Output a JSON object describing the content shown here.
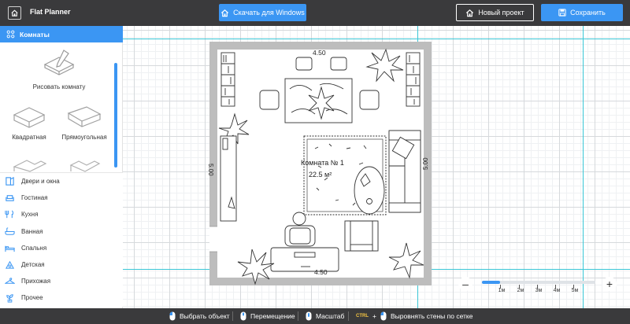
{
  "app": {
    "title": "Flat Planner",
    "download_label": "Скачать для Windows",
    "new_project_label": "Новый проект",
    "save_label": "Сохранить"
  },
  "sidebar": {
    "rooms_tab": "Комнаты",
    "draw_room": "Рисовать комнату",
    "square": "Квадратная",
    "rectangular": "Прямоугольная",
    "categories": [
      {
        "label": "Двери и окна",
        "icon": "door-icon"
      },
      {
        "label": "Гостиная",
        "icon": "sofa-icon"
      },
      {
        "label": "Кухня",
        "icon": "kitchen-icon"
      },
      {
        "label": "Ванная",
        "icon": "bathtub-icon"
      },
      {
        "label": "Спальня",
        "icon": "bed-icon"
      },
      {
        "label": "Детская",
        "icon": "kids-icon"
      },
      {
        "label": "Прихожая",
        "icon": "hanger-icon"
      },
      {
        "label": "Прочее",
        "icon": "plant-icon"
      }
    ]
  },
  "plan": {
    "top_dim": "4.50",
    "bottom_dim": "4.50",
    "left_dim": "5.00",
    "right_dim": "5.00",
    "room_name": "Комната № 1",
    "room_area": "22.5 м²"
  },
  "zoom": {
    "value_m": 1,
    "labels": [
      "1м",
      "2м",
      "3м",
      "4м",
      "5м"
    ]
  },
  "footer": {
    "select": "Выбрать объект",
    "move": "Перемещение",
    "scale": "Масштаб",
    "ctrl_key": "CTRL",
    "plus": "+",
    "align": "Выровнять стены по сетке"
  },
  "colors": {
    "accent": "#3b96f3",
    "bar": "#3a3a3c",
    "guide": "#39c6d6"
  }
}
